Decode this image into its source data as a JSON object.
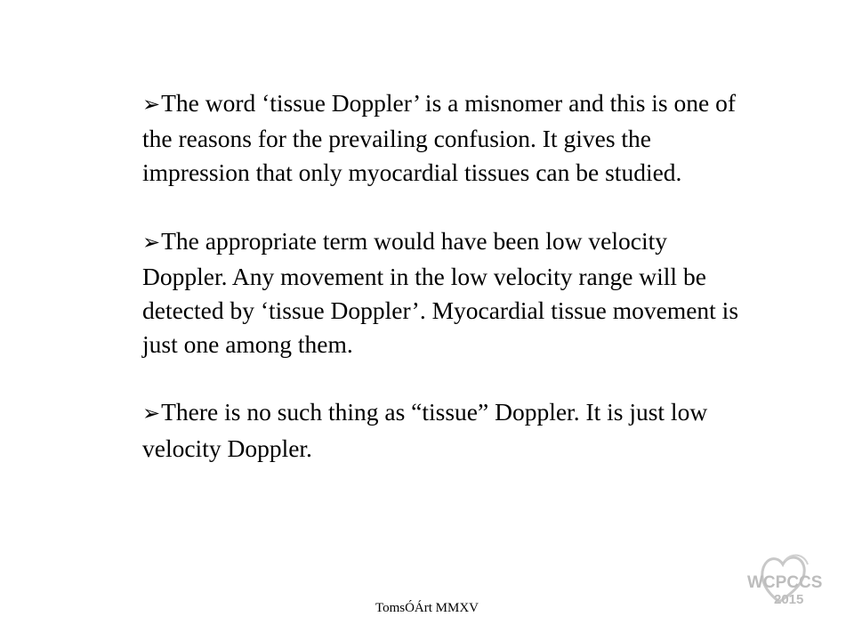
{
  "slide": {
    "bullet_glyph": "➢",
    "bullets": [
      "The word ‘tissue Doppler’ is a misnomer and this is one of the reasons for the prevailing confusion. It gives the impression that only myocardial tissues can be studied.",
      "The appropriate term would have been low velocity Doppler. Any movement in the low velocity range will be detected by ‘tissue Doppler’. Myocardial tissue movement is just one among them.",
      "There is no such thing as “tissue” Doppler. It is just low velocity Doppler."
    ]
  },
  "footer": {
    "credit": "TomsÓÁrt  MMXV"
  },
  "logo": {
    "name": "WCPCCS-logo",
    "line1": "WCPCCS",
    "line2": "2015",
    "color": "#bdbdbd"
  }
}
